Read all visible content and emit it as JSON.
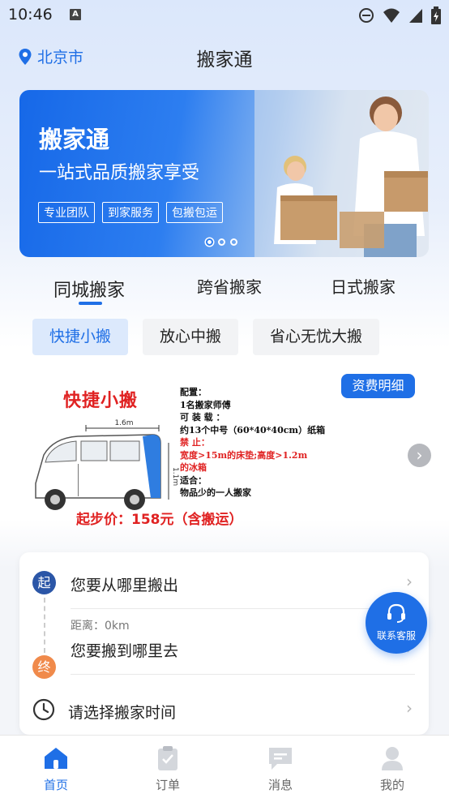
{
  "status_bar": {
    "time": "10:46",
    "badge": "A"
  },
  "header": {
    "location": "北京市",
    "title": "搬家通"
  },
  "banner": {
    "title": "搬家通",
    "subtitle": "一站式品质搬家享受",
    "tags": [
      "专业团队",
      "到家服务",
      "包搬包运"
    ],
    "active_slide": 1,
    "slide_count": 3
  },
  "tabs": [
    "同城搬家",
    "跨省搬家",
    "日式搬家"
  ],
  "subtabs": [
    "快捷小搬",
    "放心中搬",
    "省心无忧大搬"
  ],
  "package": {
    "fee_button": "资费明细",
    "title": "快捷小搬",
    "spec_lines": [
      "配置：",
      "1名搬家师傅",
      "可 装 载 ：",
      "约13个中号（60*40*40cm）纸箱"
    ],
    "forbid_lines": [
      "禁  止：",
      "宽度>15m的床垫;高度>1.2m",
      "的冰箱"
    ],
    "suit_lines": [
      "适合：",
      "物品少的一人搬家"
    ],
    "price": "起步价：158元（含搬运）",
    "dimension_length": "1.6m",
    "dimension_height": "1.1m"
  },
  "form": {
    "start_badge": "起",
    "end_badge": "终",
    "from_placeholder": "您要从哪里搬出",
    "distance": "距离：0km",
    "to_placeholder": "您要搬到哪里去",
    "time_placeholder": "请选择搬家时间"
  },
  "service": {
    "label": "联系客服"
  },
  "bottom_nav": [
    "首页",
    "订单",
    "消息",
    "我的"
  ],
  "colors": {
    "primary": "#1f6fe6",
    "start": "#2b56a7",
    "end": "#f08a4b",
    "red": "#e02222"
  }
}
